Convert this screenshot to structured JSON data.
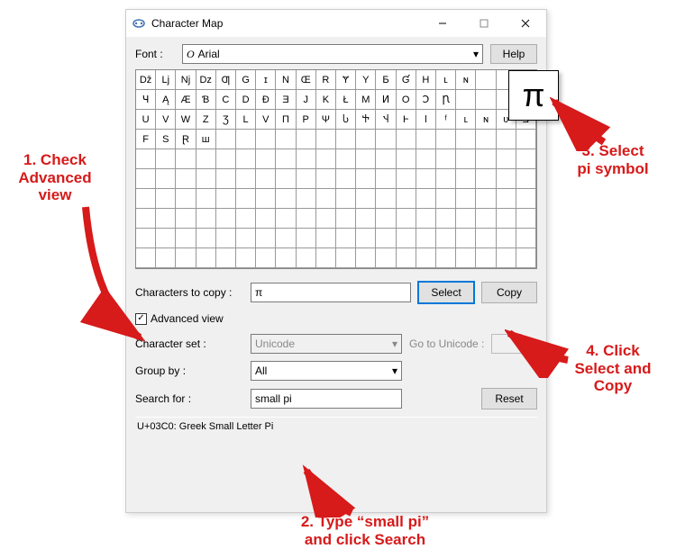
{
  "title": "Character Map",
  "font_label": "Font :",
  "font_value": "Arial",
  "help_label": "Help",
  "grid_chars": [
    "Dž",
    "Lj",
    "Nj",
    "Dz",
    "Ƣ",
    "G",
    "ɪ",
    "N",
    "Œ",
    "R",
    "Ɏ",
    "Y",
    "Ƃ",
    "Ɠ",
    "H",
    "ʟ",
    "ɴ",
    "",
    "",
    "",
    "Ɥ",
    "Ą",
    "Æ",
    "Ɓ",
    "C",
    "D",
    "Ð",
    "Ǝ",
    "J",
    "K",
    "Ł",
    "M",
    "Ͷ",
    "O",
    "Ↄ",
    "Ꞃ",
    "",
    "",
    "",
    "",
    "U",
    "V",
    "W",
    "Z",
    "Ʒ",
    "L",
    "V",
    "Π",
    "P",
    "Ψ",
    "Ⴑ",
    "Ⴕ",
    "Ⴣ",
    "Ⱶ",
    "ǀ",
    "ᶠ",
    "ʟ",
    "ɴ",
    "ᴜ",
    "Ǝ",
    "F",
    "S",
    "Ɽ",
    "ш",
    "",
    "",
    "",
    "",
    "",
    "",
    "",
    "",
    "",
    "",
    "",
    "",
    "",
    "",
    "",
    "",
    "",
    "",
    "",
    "",
    "",
    "",
    "",
    "",
    "",
    "",
    "",
    "",
    "",
    "",
    "",
    "",
    "",
    "",
    "",
    "",
    "",
    "",
    "",
    "",
    "",
    "",
    "",
    "",
    "",
    "",
    "",
    "",
    "",
    "",
    "",
    "",
    "",
    "",
    "",
    "",
    "",
    "",
    "",
    "",
    "",
    "",
    "",
    "",
    "",
    "",
    "",
    "",
    "",
    "",
    "",
    "",
    "",
    "",
    "",
    "",
    "",
    "",
    "",
    "",
    "",
    "",
    "",
    "",
    "",
    "",
    "",
    "",
    "",
    "",
    "",
    "",
    "",
    "",
    "",
    "",
    "",
    "",
    "",
    "",
    "",
    "",
    "",
    "",
    "",
    "",
    "",
    "",
    "",
    "",
    "",
    "",
    "",
    "",
    "",
    "",
    "",
    "",
    "",
    "",
    "",
    "",
    "",
    "",
    "",
    "",
    "",
    "",
    "",
    "",
    "",
    "",
    "",
    "",
    "",
    "",
    ""
  ],
  "popup_char": "π",
  "chars_to_copy_label": "Characters to copy :",
  "chars_to_copy_value": "π",
  "select_label": "Select",
  "copy_label": "Copy",
  "advanced_label": "Advanced view",
  "charset_label": "Character set :",
  "charset_value": "Unicode",
  "go_unicode_label": "Go to Unicode :",
  "groupby_label": "Group by :",
  "groupby_value": "All",
  "search_label": "Search for :",
  "search_value": "small pi",
  "reset_label": "Reset",
  "status_text": "U+03C0: Greek Small Letter Pi",
  "anno1": "1. Check\nAdvanced\nview",
  "anno2": "2. Type “small pi”\nand click Search",
  "anno3": "3. Select\npi symbol",
  "anno4": "4. Click\nSelect and\nCopy"
}
